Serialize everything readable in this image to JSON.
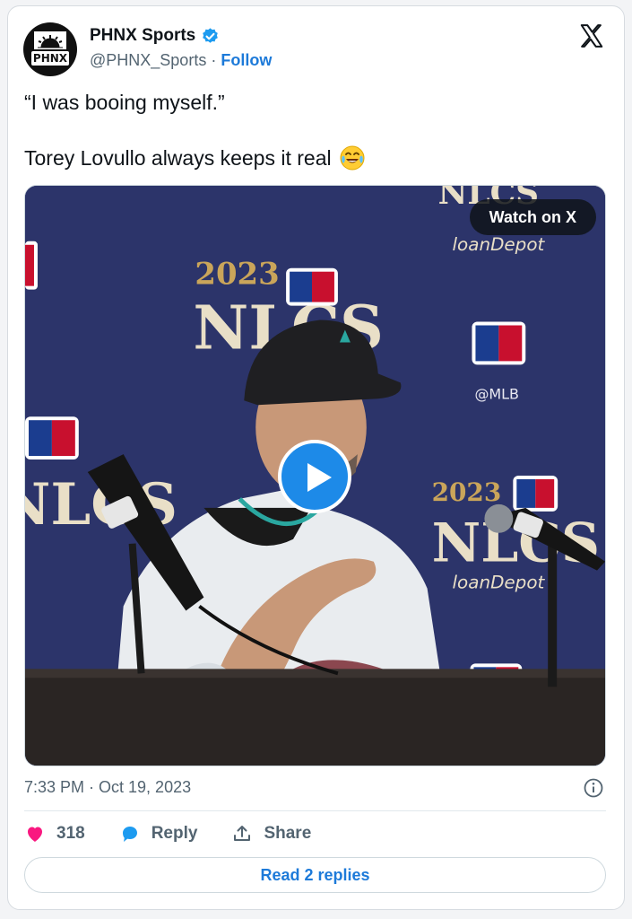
{
  "account": {
    "name": "PHNX Sports",
    "handle": "@PHNX_Sports",
    "separator": " · ",
    "follow_label": "Follow",
    "avatar_text": "PHNX"
  },
  "tweet": {
    "line1": "“I was booing myself.”",
    "line2": "Torey Lovullo always keeps it real",
    "emoji": "face-with-tears-of-joy"
  },
  "media": {
    "watch_label": "Watch on X",
    "backdrop_text": {
      "year": "2023",
      "series": "NLCS",
      "sponsor": "loanDepot",
      "mlb_handle": "@MLB"
    }
  },
  "meta": {
    "timestamp": "7:33 PM · Oct 19, 2023"
  },
  "actions": {
    "likes_count": "318",
    "reply_label": "Reply",
    "share_label": "Share"
  },
  "read_replies_label": "Read 2 replies",
  "colors": {
    "accent": "#1d7ad9",
    "like": "#f91880",
    "play": "#1d8ae8",
    "backdrop": "#2d3467"
  }
}
